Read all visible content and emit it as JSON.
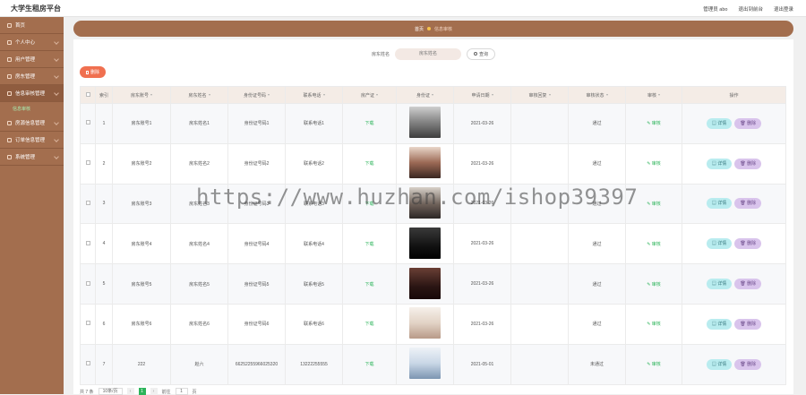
{
  "app": {
    "title": "大学生租房平台"
  },
  "header": {
    "user": "管理员 abo",
    "back_to_front": "退出到前台",
    "logout": "退出登录"
  },
  "sidebar": {
    "items": [
      {
        "label": "首页"
      },
      {
        "label": "个人中心"
      },
      {
        "label": "用户管理"
      },
      {
        "label": "房东管理"
      },
      {
        "label": "信息审核管理"
      },
      {
        "label": "房源信息管理"
      },
      {
        "label": "订单信息管理"
      },
      {
        "label": "系统管理"
      }
    ],
    "active_sub": "信息审核"
  },
  "breadcrumb": {
    "home": "首页",
    "current": "信息审核"
  },
  "search": {
    "label": "房东姓名",
    "placeholder": "房东姓名",
    "button": "查询"
  },
  "toolbar": {
    "delete_label": "删除"
  },
  "table": {
    "columns": [
      "索引",
      "房东账号",
      "房东姓名",
      "身份证号码",
      "联系电话",
      "房产证",
      "身份证",
      "申请日期",
      "审核回复",
      "审核状态",
      "审核",
      "操作"
    ],
    "rows": [
      {
        "index": "1",
        "account": "房东账号1",
        "name": "房东姓名1",
        "id_no": "身份证号码1",
        "phone": "联系电话1",
        "deed": "下载",
        "date": "2021-03-26",
        "reply": "",
        "status": "通过",
        "audit": "审核",
        "photo": "th1"
      },
      {
        "index": "2",
        "account": "房东账号2",
        "name": "房东姓名2",
        "id_no": "身份证号码2",
        "phone": "联系电话2",
        "deed": "下载",
        "date": "2021-03-26",
        "reply": "",
        "status": "通过",
        "audit": "审核",
        "photo": "th2"
      },
      {
        "index": "3",
        "account": "房东账号3",
        "name": "房东姓名3",
        "id_no": "身份证号码3",
        "phone": "联系电话3",
        "deed": "下载",
        "date": "2021-03-26",
        "reply": "",
        "status": "通过",
        "audit": "审核",
        "photo": "th3"
      },
      {
        "index": "4",
        "account": "房东账号4",
        "name": "房东姓名4",
        "id_no": "身份证号码4",
        "phone": "联系电话4",
        "deed": "下载",
        "date": "2021-03-26",
        "reply": "",
        "status": "通过",
        "audit": "审核",
        "photo": "th4"
      },
      {
        "index": "5",
        "account": "房东账号5",
        "name": "房东姓名5",
        "id_no": "身份证号码5",
        "phone": "联系电话5",
        "deed": "下载",
        "date": "2021-03-26",
        "reply": "",
        "status": "通过",
        "audit": "审核",
        "photo": "th5"
      },
      {
        "index": "6",
        "account": "房东账号6",
        "name": "房东姓名6",
        "id_no": "身份证号码6",
        "phone": "联系电话6",
        "deed": "下载",
        "date": "2021-03-26",
        "reply": "",
        "status": "通过",
        "audit": "审核",
        "photo": "th6"
      },
      {
        "index": "7",
        "account": "222",
        "name": "赵六",
        "id_no": "66252255966025320",
        "phone": "13222255555",
        "deed": "下载",
        "date": "2021-05-01",
        "reply": "",
        "status": "未通过",
        "audit": "审核",
        "photo": "th7"
      }
    ],
    "detail_label": "详情",
    "delete_label": "删除"
  },
  "pager": {
    "total": "共 7 条",
    "page_size": "10条/页",
    "current": "1",
    "goto_label": "前往",
    "goto_value": "1",
    "page_suffix": "页"
  },
  "watermark": "https://www.huzhan.com/ishop39397",
  "colors": {
    "sidebar": "#a36e4e",
    "accent_green": "#2cb45a",
    "delete_btn": "#f07050",
    "detail_btn": "#b9ecef",
    "row_delete_btn": "#d9c4ec"
  }
}
